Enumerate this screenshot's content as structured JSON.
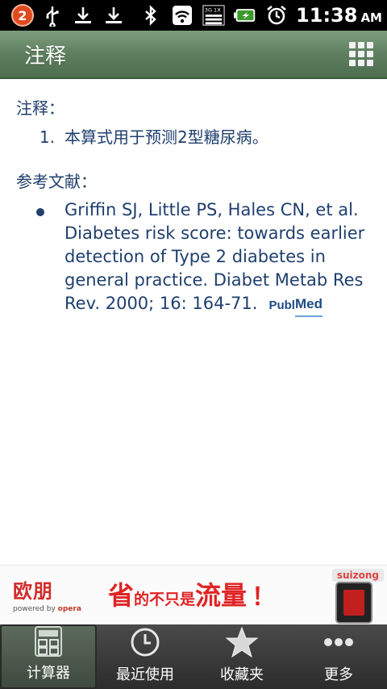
{
  "status_bar": {
    "notification_count": "2",
    "time": "11:38",
    "ampm": "AM",
    "network_label": "3G 1X"
  },
  "header": {
    "title": "注释"
  },
  "content": {
    "notes_heading": "注释：",
    "notes": [
      {
        "num": "1.",
        "text": "本算式用于预测2型糖尿病。"
      }
    ],
    "refs_heading": "参考文献：",
    "references": [
      {
        "text": "Griffin SJ, Little PS, Hales CN, et al. Diabetes risk score: towards earlier detection of Type 2 diabetes in general practice. Diabet Metab Res Rev. 2000; 16: 164-71.",
        "pubmed_prefix": "Publ",
        "pubmed_suffix": "Med"
      }
    ]
  },
  "ad": {
    "brand": "欧朋",
    "powered": "powered by",
    "powered_brand": "opera",
    "slogan_1": "省",
    "slogan_2": "的不只是",
    "slogan_3": "流量",
    "slogan_4": "！",
    "brand2": "suizong"
  },
  "tabs": [
    {
      "label": "计算器",
      "icon": "calculator-icon",
      "active": true
    },
    {
      "label": "最近使用",
      "icon": "clock-icon",
      "active": false
    },
    {
      "label": "收藏夹",
      "icon": "star-icon",
      "active": false
    },
    {
      "label": "更多",
      "icon": "more-icon",
      "active": false
    }
  ]
}
